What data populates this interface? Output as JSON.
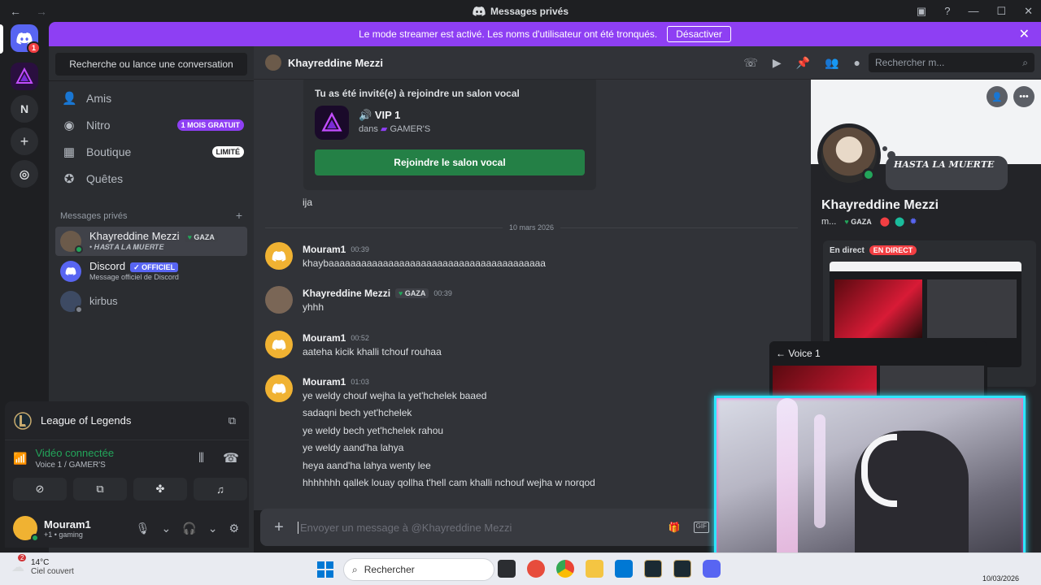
{
  "window": {
    "title": "Messages privés"
  },
  "banner": {
    "text": "Le mode streamer est activé. Les noms d'utilisateur ont été tronqués.",
    "button": "Désactiver"
  },
  "servers": {
    "home_badge": "1",
    "n_label": "N"
  },
  "sidebar": {
    "search": "Recherche ou lance une conversation",
    "nav": [
      {
        "label": "Amis"
      },
      {
        "label": "Nitro",
        "tag": "1 MOIS GRATUIT"
      },
      {
        "label": "Boutique",
        "tag": "LIMITÉ"
      },
      {
        "label": "Quêtes"
      }
    ],
    "dm_header": "Messages privés",
    "dms": [
      {
        "name": "Khayreddine Mezzi",
        "badge": "GAZA",
        "sub": "• 𝑯𝑨𝑺𝑻𝑨 𝑳𝑨 𝑴𝑼𝑬𝑹𝑻𝑬"
      },
      {
        "name": "Discord",
        "badge": "OFFICIEL",
        "sub": "Message officiel de Discord"
      },
      {
        "name": "kirbus"
      }
    ]
  },
  "voice": {
    "game": "League of Legends",
    "status": "Vidéo connectée",
    "channel": "Voice 1 /",
    "server": "GAMER'S"
  },
  "user": {
    "name": "Mouram1",
    "sub": "+1 • gaming"
  },
  "chat": {
    "recipient": "Khayreddine Mezzi",
    "search_placeholder": "Rechercher m...",
    "invite": {
      "heading": "Tu as été invité(e) à rejoindre un salon vocal",
      "channel": "VIP 1",
      "in": "dans",
      "server": "GAMER'S",
      "join": "Rejoindre le salon vocal"
    },
    "pre_line": "ija",
    "date": "10 mars 2026",
    "messages": [
      {
        "author": "Mouram1",
        "time": "00:39",
        "lines": [
          "khaybaaaaaaaaaaaaaaaaaaaaaaaaaaaaaaaaaaaaaaaa"
        ]
      },
      {
        "author": "Khayreddine Mezzi",
        "badge": "GAZA",
        "time": "00:39",
        "lines": [
          "yhhh"
        ]
      },
      {
        "author": "Mouram1",
        "time": "00:52",
        "lines": [
          "aateha kicik khalli tchouf rouhaa"
        ]
      },
      {
        "author": "Mouram1",
        "time": "01:03",
        "lines": [
          "ye weldy chouf wejha la yet'hchelek baaed",
          "sadaqni bech yet'hchelek",
          "ye weldy bech yet'hchelek rahou",
          "ye weldy aand'ha lahya",
          "heya aand'ha lahya wenty lee",
          "hhhhhhh qallek louay qollha t'hell cam khalli nchouf wejha w norqod"
        ]
      }
    ],
    "composer_placeholder": "Envoyer un message à @Khayreddine Mezzi"
  },
  "profile": {
    "status": "𝑯𝑨𝑺𝑻𝑨 𝑳𝑨 𝑴𝑼𝑬𝑹𝑻𝑬",
    "name": "Khayreddine Mezzi",
    "short": "m...",
    "badge": "GAZA",
    "live_label": "En direct",
    "live_badge": "EN DIRECT"
  },
  "overlay": {
    "voice_title": "← Voice 1"
  },
  "taskbar": {
    "temp": "14°C",
    "weather": "Ciel couvert",
    "weather_badge": "2",
    "search": "Rechercher",
    "date": "10/03/2026"
  },
  "colors": {
    "brand": "#5865f2",
    "banner": "#8e3ff3",
    "online": "#23a55a",
    "join": "#248046",
    "live": "#f23f43"
  }
}
